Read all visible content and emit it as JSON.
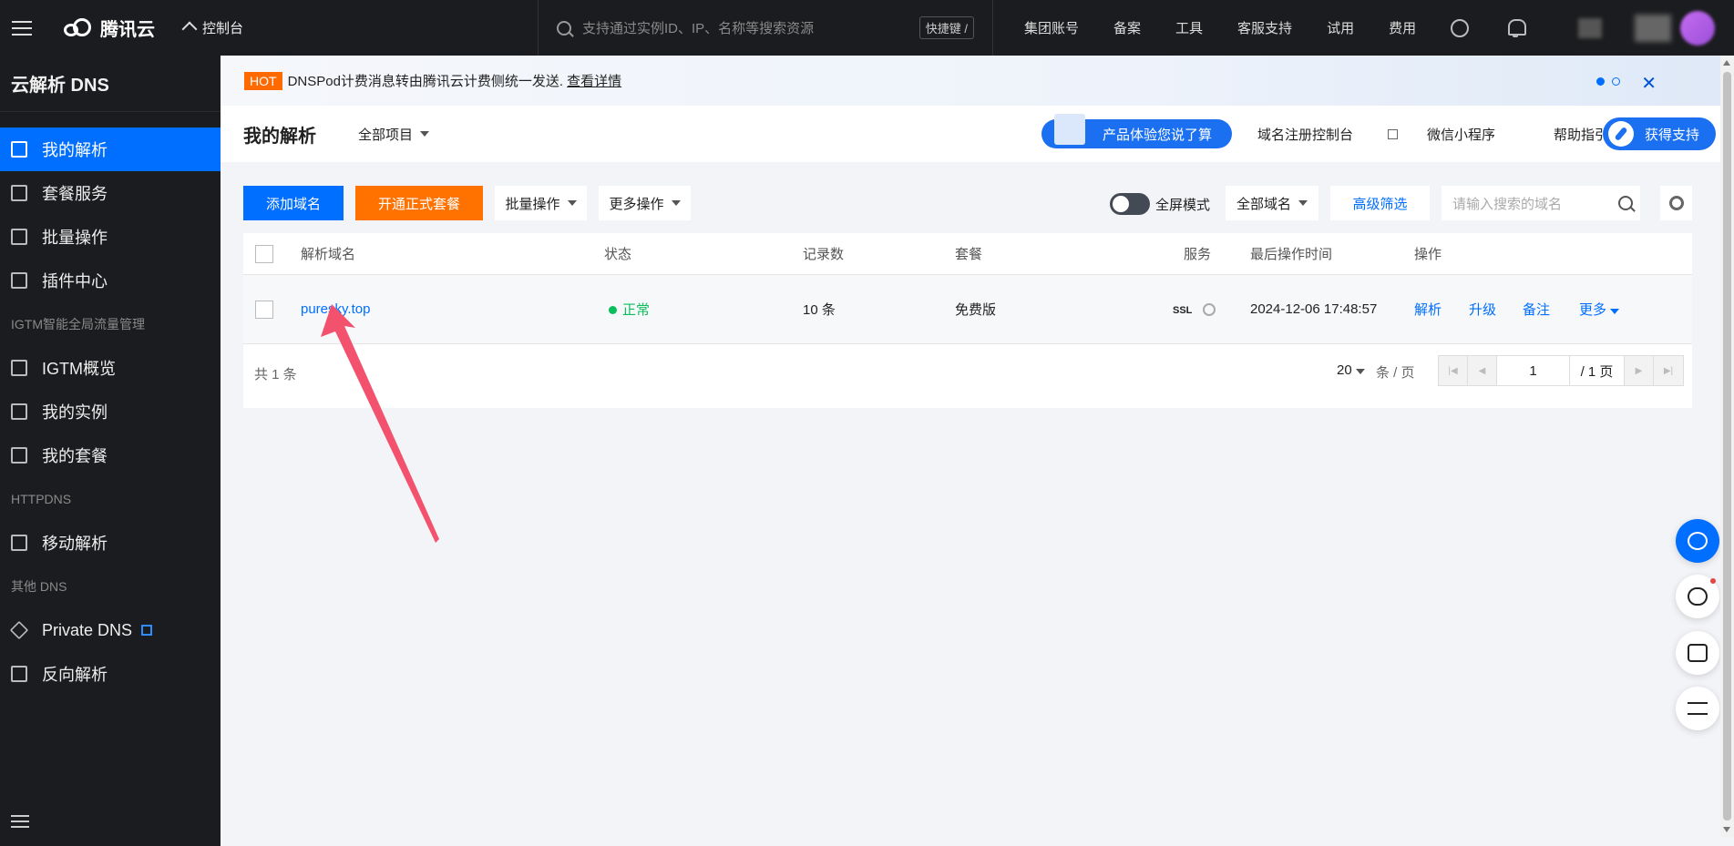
{
  "topbar": {
    "brand": "腾讯云",
    "console": "控制台",
    "search_placeholder": "支持通过实例ID、IP、名称等搜索资源",
    "shortcut": "快捷键 /",
    "nav": [
      "集团账号",
      "备案",
      "工具",
      "客服支持",
      "试用",
      "费用"
    ]
  },
  "sidebar": {
    "title": "云解析 DNS",
    "items_main": [
      {
        "label": "我的解析",
        "icon": "dns-record-icon",
        "active": true
      },
      {
        "label": "套餐服务",
        "icon": "package-icon"
      },
      {
        "label": "批量操作",
        "icon": "batch-icon"
      },
      {
        "label": "插件中心",
        "icon": "plugin-icon"
      }
    ],
    "group_igtm": "IGTM智能全局流量管理",
    "items_igtm": [
      {
        "label": "IGTM概览",
        "icon": "grid-icon"
      },
      {
        "label": "我的实例",
        "icon": "instance-icon"
      },
      {
        "label": "我的套餐",
        "icon": "package-icon"
      }
    ],
    "group_httpdns": "HTTPDNS",
    "items_httpdns": [
      {
        "label": "移动解析",
        "icon": "mobile-dns-icon"
      }
    ],
    "group_other": "其他 DNS",
    "items_other": [
      {
        "label": "Private DNS",
        "icon": "diamond-icon"
      },
      {
        "label": "反向解析",
        "icon": "reverse-icon"
      }
    ]
  },
  "banner": {
    "hot": "HOT",
    "text": "DNSPod计费消息转由腾讯云计费侧统一发送.",
    "link": "查看详情"
  },
  "header": {
    "title": "我的解析",
    "project": "全部项目",
    "feedback": "产品体验您说了算",
    "links": [
      "域名注册控制台",
      "微信小程序",
      "帮助指引"
    ],
    "support": "获得支持"
  },
  "toolbar": {
    "add_domain": "添加域名",
    "open_package": "开通正式套餐",
    "batch": "批量操作",
    "more_ops": "更多操作",
    "fullscreen": "全屏模式",
    "all_domains": "全部域名",
    "advanced_filter": "高级筛选",
    "search_placeholder": "请输入搜索的域名"
  },
  "table": {
    "columns": [
      "解析域名",
      "状态",
      "记录数",
      "套餐",
      "服务",
      "最后操作时间",
      "操作"
    ],
    "rows": [
      {
        "domain": "puresky.top",
        "status": "正常",
        "records": "10 条",
        "plan": "免费版",
        "service": "SSL",
        "last_time": "2024-12-06 17:48:57",
        "actions": [
          "解析",
          "升级",
          "备注",
          "更多"
        ]
      }
    ],
    "footer": {
      "total": "共 1 条",
      "page_size": "20",
      "per_page": "条 / 页",
      "page": "1",
      "total_pages": "/ 1 页"
    }
  },
  "colors": {
    "primary": "#006eff",
    "orange": "#ff7200",
    "status_ok": "#0abf5b",
    "annotation_arrow": "#f2526e"
  }
}
